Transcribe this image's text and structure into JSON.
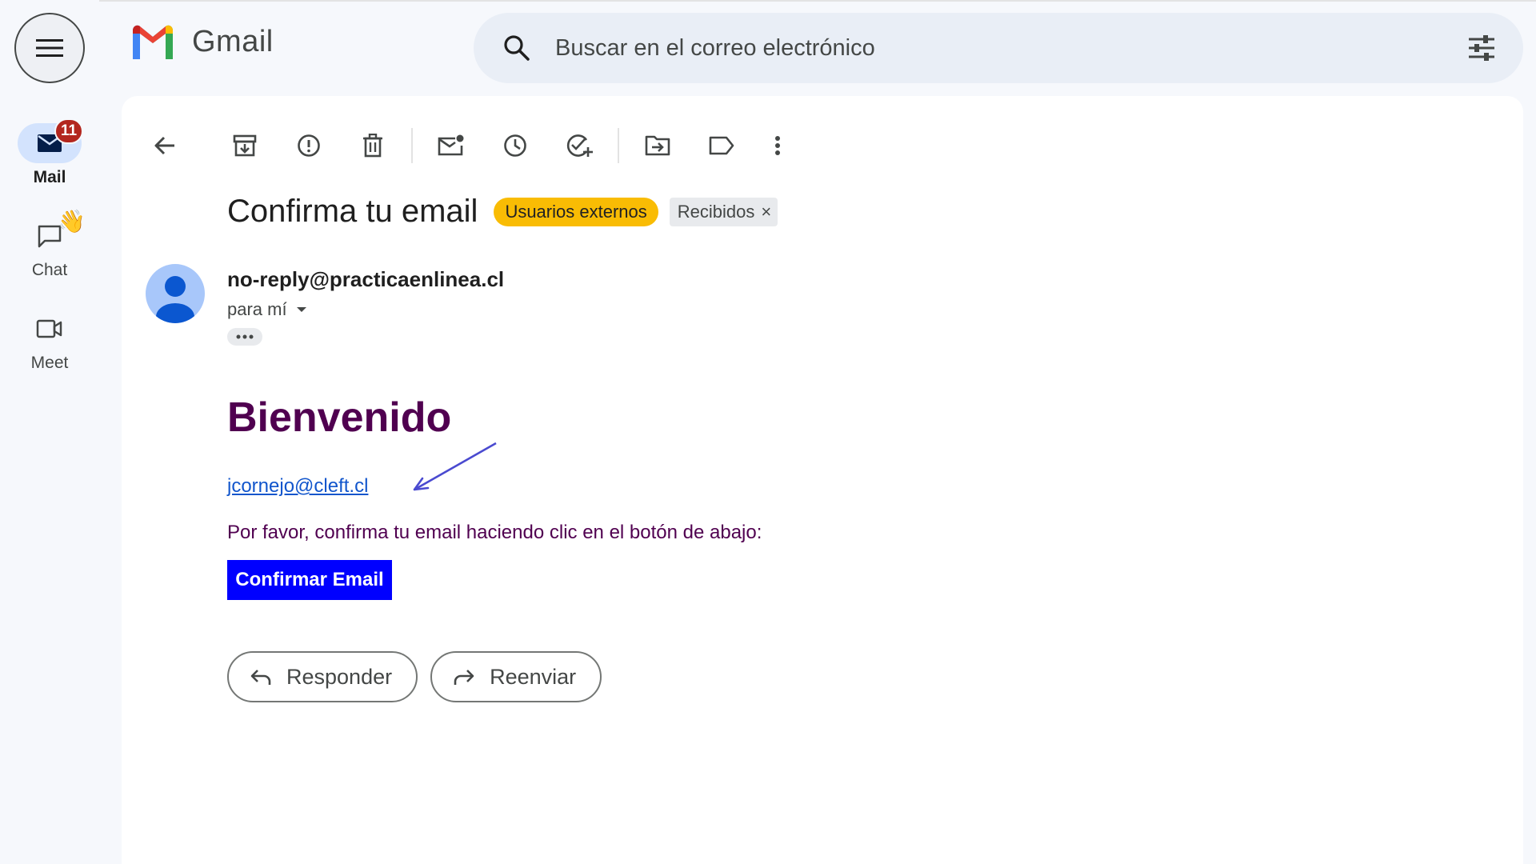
{
  "app": {
    "name": "Gmail"
  },
  "colors": {
    "accent": "#0b57d0",
    "label_chip": "#f9bc04",
    "brand_purple": "#500050",
    "confirm_button": "#0000ff",
    "badge": "#b3261e"
  },
  "nav": {
    "items": [
      {
        "label": "Mail",
        "icon": "mail-icon",
        "badge": "11",
        "active": true
      },
      {
        "label": "Chat",
        "icon": "chat-icon",
        "extra": "👋"
      },
      {
        "label": "Meet",
        "icon": "video-icon"
      }
    ]
  },
  "search": {
    "placeholder": "Buscar en el correo electrónico"
  },
  "toolbar": {
    "buttons": [
      "back-icon",
      "archive-icon",
      "report-spam-icon",
      "delete-icon",
      "mark-unread-icon",
      "snooze-icon",
      "add-task-icon",
      "move-to-icon",
      "labels-icon",
      "more-icon"
    ]
  },
  "email": {
    "subject": "Confirma tu email",
    "labels": [
      "Usuarios externos"
    ],
    "folder_chip": "Recibidos",
    "folder_chip_close": "×",
    "sender": "no-reply@practicaenlinea.cl",
    "recipient_line": "para mí",
    "body": {
      "heading": "Bienvenido",
      "email_link": "jcornejo@cleft.cl",
      "instruction": "Por favor, confirma tu email haciendo clic en el botón de abajo:",
      "button": "Confirmar Email"
    }
  },
  "actions": {
    "reply": "Responder",
    "forward": "Reenviar"
  }
}
